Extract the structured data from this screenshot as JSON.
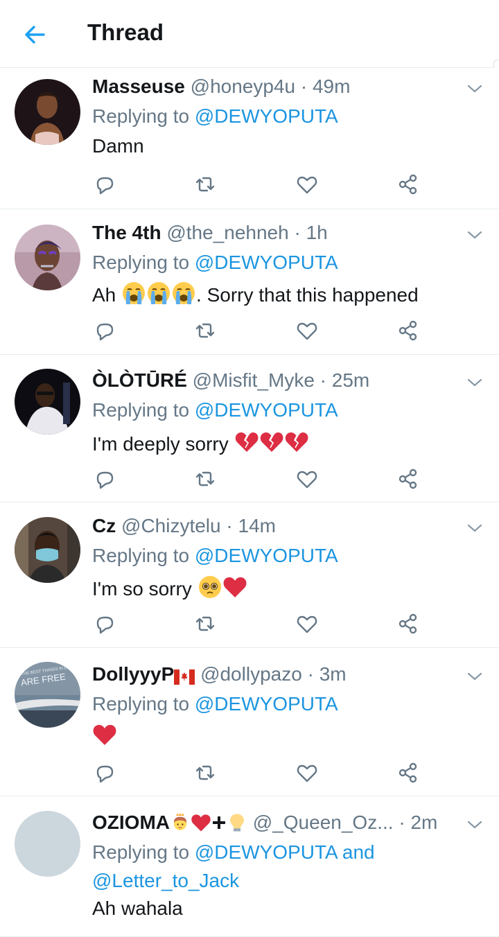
{
  "header": {
    "title": "Thread",
    "back_icon": "arrow-left-icon",
    "accent": "#1da1f2"
  },
  "colors": {
    "mention": "#1b95e0",
    "muted": "#657786",
    "text": "#14171a"
  },
  "replies": [
    {
      "name": "Masseuse",
      "handle": "@honeyp4u",
      "dot": "·",
      "time": "49m",
      "replying_prefix": "Replying to",
      "mentions": "@DEWYOPUTA",
      "mentions2": "",
      "text": "Damn",
      "text_suffix": "",
      "emoji_after_text": [],
      "name_emoji": []
    },
    {
      "name": "The 4th",
      "handle": "@the_nehneh",
      "dot": "·",
      "time": "1h",
      "replying_prefix": "Replying to",
      "mentions": "@DEWYOPUTA",
      "mentions2": "",
      "text": "Ah",
      "text_suffix": ". Sorry that this happened",
      "emoji_after_text": [
        "loudly-crying-face",
        "loudly-crying-face",
        "loudly-crying-face"
      ],
      "name_emoji": []
    },
    {
      "name": "ÒLÒTŪRÉ",
      "handle": "@Misfit_Myke",
      "dot": "·",
      "time": "25m",
      "replying_prefix": "Replying to",
      "mentions": "@DEWYOPUTA",
      "mentions2": "",
      "text": "I'm deeply sorry",
      "text_suffix": "",
      "emoji_after_text": [
        "broken-heart",
        "broken-heart",
        "broken-heart"
      ],
      "name_emoji": []
    },
    {
      "name": "Cz",
      "handle": "@Chizytelu",
      "dot": "·",
      "time": "14m",
      "replying_prefix": "Replying to",
      "mentions": "@DEWYOPUTA",
      "mentions2": "",
      "text": "I'm so sorry",
      "text_suffix": "",
      "emoji_after_text": [
        "pleading-face",
        "red-heart"
      ],
      "name_emoji": []
    },
    {
      "name": "DollyyyP",
      "handle": "@dollypazo",
      "dot": "·",
      "time": "3m",
      "replying_prefix": "Replying to",
      "mentions": "@DEWYOPUTA",
      "mentions2": "",
      "text": "",
      "text_suffix": "",
      "emoji_after_text": [
        "red-heart"
      ],
      "name_emoji": [
        "canada-flag"
      ],
      "avatar_caption_top": "THE BEST THINGS IN LIFE",
      "avatar_caption": "ARE FREE"
    },
    {
      "name": "OZIOMA",
      "handle": "@_Queen_Oz...",
      "dot": "·",
      "time": "2m",
      "replying_prefix": "Replying to",
      "mentions": "@DEWYOPUTA and",
      "mentions2": "@Letter_to_Jack",
      "text": "Ah wahala",
      "text_suffix": "",
      "emoji_after_text": [],
      "name_emoji": [
        "princess",
        "red-heart",
        "plus",
        "light-bulb"
      ]
    }
  ],
  "action_icons": [
    "reply-icon",
    "retweet-icon",
    "like-icon",
    "share-icon"
  ]
}
